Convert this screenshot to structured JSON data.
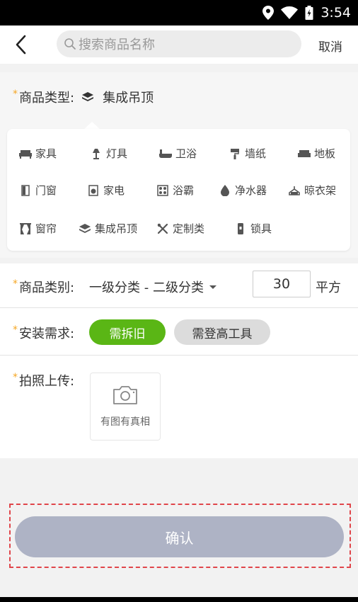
{
  "status_bar": {
    "time": "3:54"
  },
  "header": {
    "search_placeholder": "搜索商品名称",
    "cancel_label": "取消"
  },
  "product_type": {
    "label": "商品类型:",
    "selected": "集成吊顶",
    "options": [
      {
        "label": "家具",
        "icon": "sofa-icon"
      },
      {
        "label": "灯具",
        "icon": "lamp-icon"
      },
      {
        "label": "卫浴",
        "icon": "bathtub-icon"
      },
      {
        "label": "墙纸",
        "icon": "paint-roller-icon"
      },
      {
        "label": "地板",
        "icon": "floor-icon"
      },
      {
        "label": "门窗",
        "icon": "door-icon"
      },
      {
        "label": "家电",
        "icon": "washing-machine-icon"
      },
      {
        "label": "浴霸",
        "icon": "heater-icon"
      },
      {
        "label": "净水器",
        "icon": "water-drop-icon"
      },
      {
        "label": "晾衣架",
        "icon": "hanger-icon"
      },
      {
        "label": "窗帘",
        "icon": "curtain-icon"
      },
      {
        "label": "集成吊顶",
        "icon": "ceiling-icon"
      },
      {
        "label": "定制类",
        "icon": "tools-icon"
      },
      {
        "label": "锁具",
        "icon": "lock-icon"
      }
    ]
  },
  "category": {
    "label": "商品类别:",
    "value": "一级分类 - 二级分类",
    "quantity": "30",
    "unit": "平方"
  },
  "install": {
    "label": "安装需求:",
    "chips": [
      {
        "label": "需拆旧",
        "selected": true
      },
      {
        "label": "需登高工具",
        "selected": false
      }
    ]
  },
  "photo": {
    "label": "拍照上传:",
    "hint": "有图有真相"
  },
  "confirm_label": "确认",
  "colors": {
    "accent_green": "#5ab615",
    "required_star": "#f5a623",
    "confirm_bg": "#aeb3c5",
    "dashed_border": "#e0454a"
  }
}
